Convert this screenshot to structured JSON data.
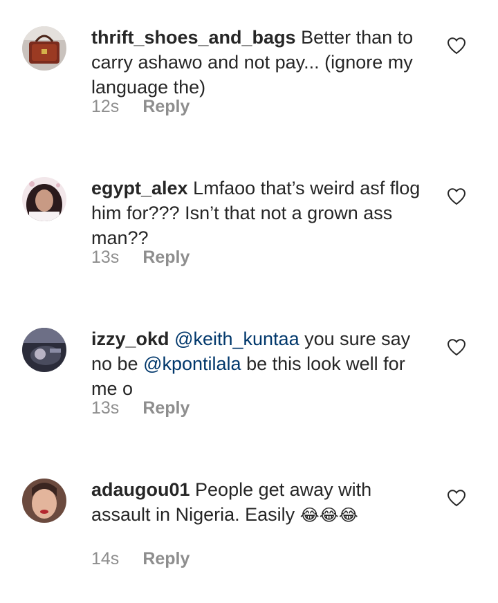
{
  "comments": [
    {
      "username": "thrift_shoes_and_bags",
      "parts": [
        {
          "text": " Better than to carry ashawo and not pay... (ignore my language the)",
          "mention": false
        }
      ],
      "time": "12s",
      "reply_label": "Reply",
      "avatar_icon": "handbag-avatar"
    },
    {
      "username": "egypt_alex",
      "parts": [
        {
          "text": " Lmfaoo that’s weird asf flog him for??? Isn’t that not a grown ass man??",
          "mention": false
        }
      ],
      "time": "13s",
      "reply_label": "Reply",
      "avatar_icon": "woman-avatar"
    },
    {
      "username": "izzy_okd",
      "parts": [
        {
          "text": " ",
          "mention": false
        },
        {
          "text": "@keith_kuntaa",
          "mention": true
        },
        {
          "text": " you sure say no be ",
          "mention": false
        },
        {
          "text": "@kpontilala",
          "mention": true
        },
        {
          "text": " be this look well for me o",
          "mention": false
        }
      ],
      "time": "13s",
      "reply_label": "Reply",
      "avatar_icon": "car-avatar"
    },
    {
      "username": "adaugou01",
      "parts": [
        {
          "text": " People get away with assault in Nigeria. Easily ",
          "mention": false
        }
      ],
      "emoji": "😂😂😂",
      "time": "14s",
      "reply_label": "Reply",
      "avatar_icon": "woman-avatar"
    }
  ],
  "colors": {
    "text": "#262626",
    "secondary": "#8e8e8e",
    "mention": "#00376b"
  }
}
